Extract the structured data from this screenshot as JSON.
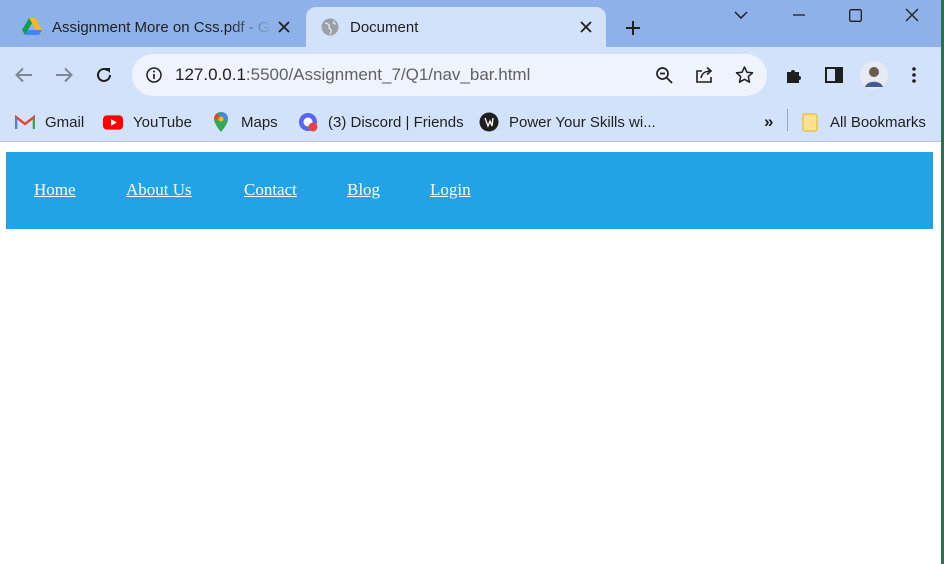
{
  "browser": {
    "tabs": [
      {
        "title": "Assignment More on Css.pdf - G",
        "favicon": "google-drive-icon",
        "active": false
      },
      {
        "title": "Document",
        "favicon": "globe-icon",
        "active": true
      }
    ],
    "address_bar": {
      "host": "127.0.0.1",
      "path": ":5500/Assignment_7/Q1/nav_bar.html"
    },
    "bookmarks": [
      {
        "label": "Gmail",
        "icon": "gmail-icon"
      },
      {
        "label": "YouTube",
        "icon": "youtube-icon"
      },
      {
        "label": "Maps",
        "icon": "maps-icon"
      },
      {
        "label": "(3) Discord | Friends",
        "icon": "discord-icon"
      },
      {
        "label": "Power Your Skills wi...",
        "icon": "site-icon"
      }
    ],
    "overflow_label": "»",
    "all_bookmarks_label": "All Bookmarks"
  },
  "page": {
    "nav_color": "#22a3e6",
    "links": [
      "Home",
      "About Us",
      "Contact",
      "Blog",
      "Login"
    ]
  }
}
